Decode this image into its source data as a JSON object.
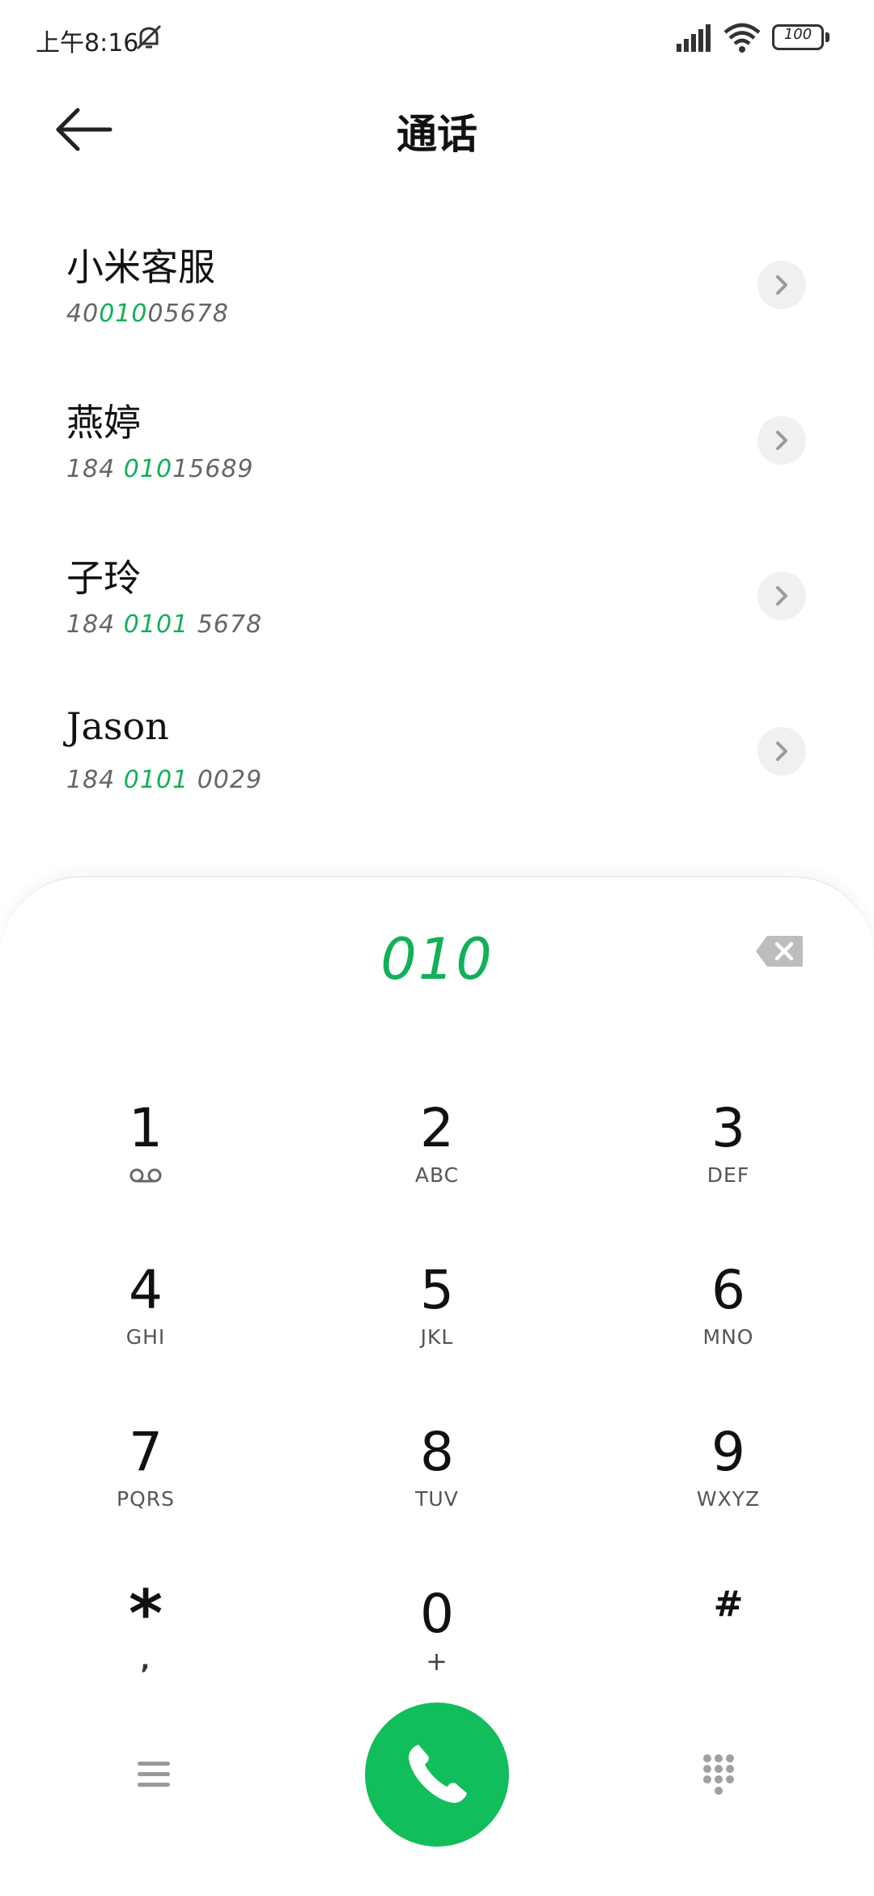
{
  "status_bar": {
    "time": "上午8:16",
    "battery": "100"
  },
  "header": {
    "title": "通话"
  },
  "contacts": [
    {
      "name": "小米客服",
      "number_pre": "40",
      "number_hl": "010",
      "number_post": "05678"
    },
    {
      "name": "燕婷",
      "number_pre": "184 ",
      "number_hl": "010",
      "number_post": "15689"
    },
    {
      "name": "子玲",
      "number_pre": "184 ",
      "number_hl": "0101",
      "number_post": " 5678"
    },
    {
      "name": "Jason",
      "number_pre": "184 ",
      "number_hl": "0101",
      "number_post": " 0029"
    }
  ],
  "dialer": {
    "input": "010",
    "keys": [
      {
        "digit": "1",
        "letters": ""
      },
      {
        "digit": "2",
        "letters": "ABC"
      },
      {
        "digit": "3",
        "letters": "DEF"
      },
      {
        "digit": "4",
        "letters": "GHI"
      },
      {
        "digit": "5",
        "letters": "JKL"
      },
      {
        "digit": "6",
        "letters": "MNO"
      },
      {
        "digit": "7",
        "letters": "PQRS"
      },
      {
        "digit": "8",
        "letters": "TUV"
      },
      {
        "digit": "9",
        "letters": "WXYZ"
      },
      {
        "digit": "*",
        "letters": ","
      },
      {
        "digit": "0",
        "letters": "+"
      },
      {
        "digit": "#",
        "letters": ""
      }
    ]
  },
  "colors": {
    "accent": "#12b05a",
    "call_button": "#12bd5b"
  },
  "icons": {
    "back": "arrow-left-icon",
    "voicemail": "voicemail-icon",
    "backspace": "backspace-icon",
    "menu": "menu-icon",
    "call": "phone-icon",
    "keypad": "dialpad-icon"
  }
}
